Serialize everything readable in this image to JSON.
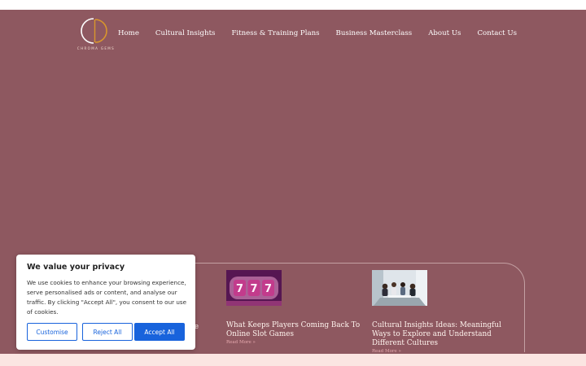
{
  "brand": {
    "name": "CHROMA GEMS",
    "icon": "chroma-gems-logo"
  },
  "nav": [
    "Home",
    "Cultural Insights",
    "Fitness & Training Plans",
    "Business Masterclass",
    "About Us",
    "Contact Us"
  ],
  "posts": [
    {
      "title_partial": [
        "at",
        "rience"
      ]
    },
    {
      "title": "What Keeps Players Coming Back To Online Slot Games",
      "read_more": "Read More »",
      "image": "slot-machine-777"
    },
    {
      "title": "Cultural Insights Ideas: Meaningful Ways to Explore and Understand Different Cultures",
      "read_more": "Read More »",
      "image": "meeting-room"
    }
  ],
  "cookie": {
    "heading": "We value your privacy",
    "body": "We use cookies to enhance your browsing experience, serve personalised ads or content, and analyse our traffic. By clicking \"Accept All\", you consent to our use of cookies.",
    "customise": "Customise",
    "reject": "Reject All",
    "accept": "Accept All"
  },
  "colors": {
    "background": "#8e5860",
    "accent": "#1863dc",
    "footer": "#fbe5e2"
  }
}
